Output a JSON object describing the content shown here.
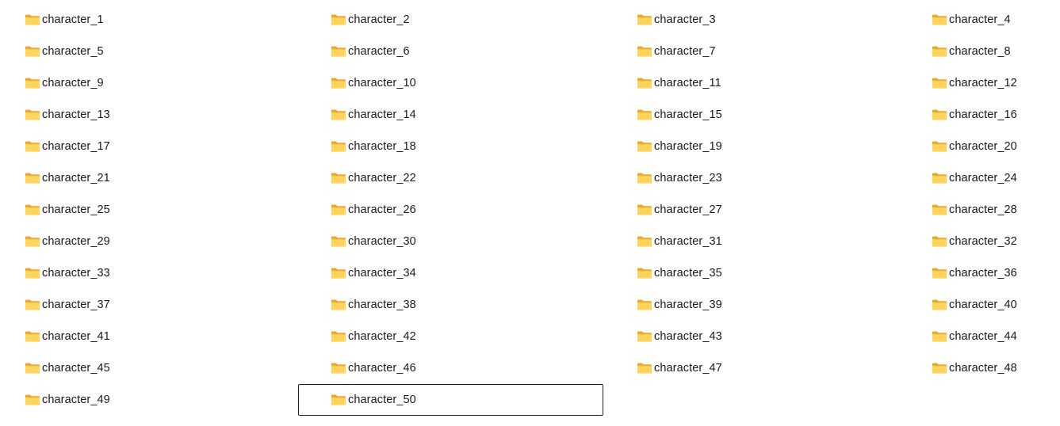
{
  "folder_view": {
    "icon": "folder-icon",
    "focused_item": "character_50",
    "items": [
      "character_1",
      "character_2",
      "character_3",
      "character_4",
      "character_5",
      "character_6",
      "character_7",
      "character_8",
      "character_9",
      "character_10",
      "character_11",
      "character_12",
      "character_13",
      "character_14",
      "character_15",
      "character_16",
      "character_17",
      "character_18",
      "character_19",
      "character_20",
      "character_21",
      "character_22",
      "character_23",
      "character_24",
      "character_25",
      "character_26",
      "character_27",
      "character_28",
      "character_29",
      "character_30",
      "character_31",
      "character_32",
      "character_33",
      "character_34",
      "character_35",
      "character_36",
      "character_37",
      "character_38",
      "character_39",
      "character_40",
      "character_41",
      "character_42",
      "character_43",
      "character_44",
      "character_45",
      "character_46",
      "character_47",
      "character_48",
      "character_49",
      "character_50"
    ]
  },
  "colors": {
    "folder_back": "#E8A92B",
    "folder_front": "#FFD35C",
    "focus_border": "#1F1F1F"
  }
}
